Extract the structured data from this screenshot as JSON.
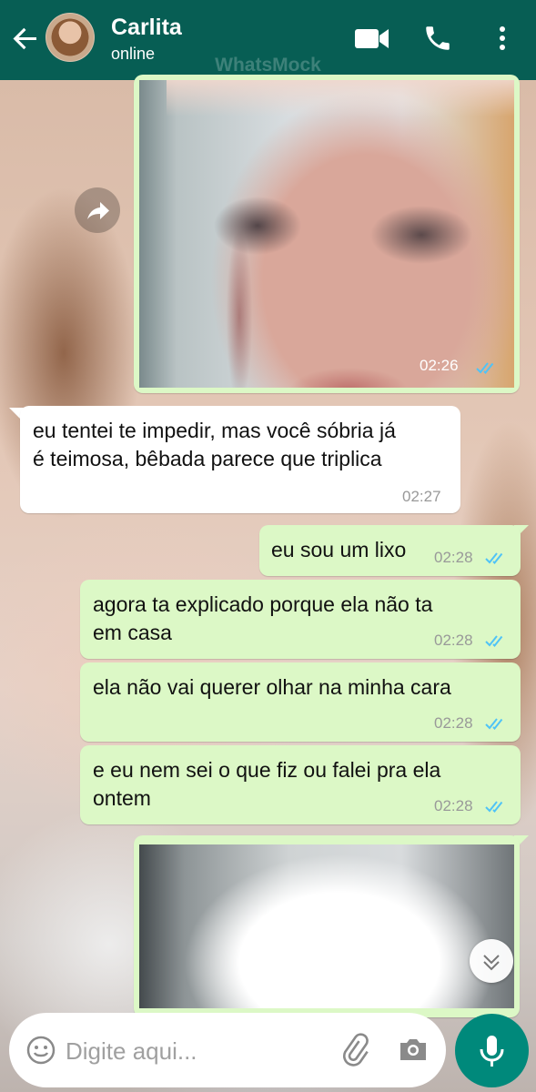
{
  "header": {
    "contact_name": "Carlita",
    "status": "online",
    "watermark": "WhatsMock",
    "icons": [
      "back-arrow-icon",
      "video-call-icon",
      "phone-call-icon",
      "more-vert-icon"
    ],
    "color": "#075e54"
  },
  "messages": [
    {
      "type": "image",
      "direction": "out",
      "time": "02:26",
      "read": true
    },
    {
      "type": "text",
      "direction": "in",
      "text_line1": "eu tentei te impedir, mas você sóbria já",
      "text_line2": "é teimosa, bêbada parece que triplica",
      "time": "02:27"
    },
    {
      "type": "text",
      "direction": "out",
      "text_line1": "eu sou um lixo",
      "time": "02:28",
      "read": true
    },
    {
      "type": "text",
      "direction": "out",
      "text_line1": "agora ta explicado porque ela não ta",
      "text_line2": "em casa",
      "time": "02:28",
      "read": true
    },
    {
      "type": "text",
      "direction": "out",
      "text_line1": "ela não vai querer olhar na minha cara",
      "time": "02:28",
      "read": true
    },
    {
      "type": "text",
      "direction": "out",
      "text_line1": "e eu nem sei o que fiz ou falei pra ela",
      "text_line2": "ontem",
      "time": "02:28",
      "read": true
    },
    {
      "type": "image",
      "direction": "out"
    }
  ],
  "composer": {
    "placeholder": "Digite aqui...",
    "icons": [
      "emoji-icon",
      "attach-icon",
      "camera-icon",
      "mic-icon"
    ]
  },
  "colors": {
    "outgoing_bubble": "#dcf8c6",
    "incoming_bubble": "#ffffff",
    "read_ticks": "#4fc3f7",
    "mic_button": "#00897b"
  }
}
